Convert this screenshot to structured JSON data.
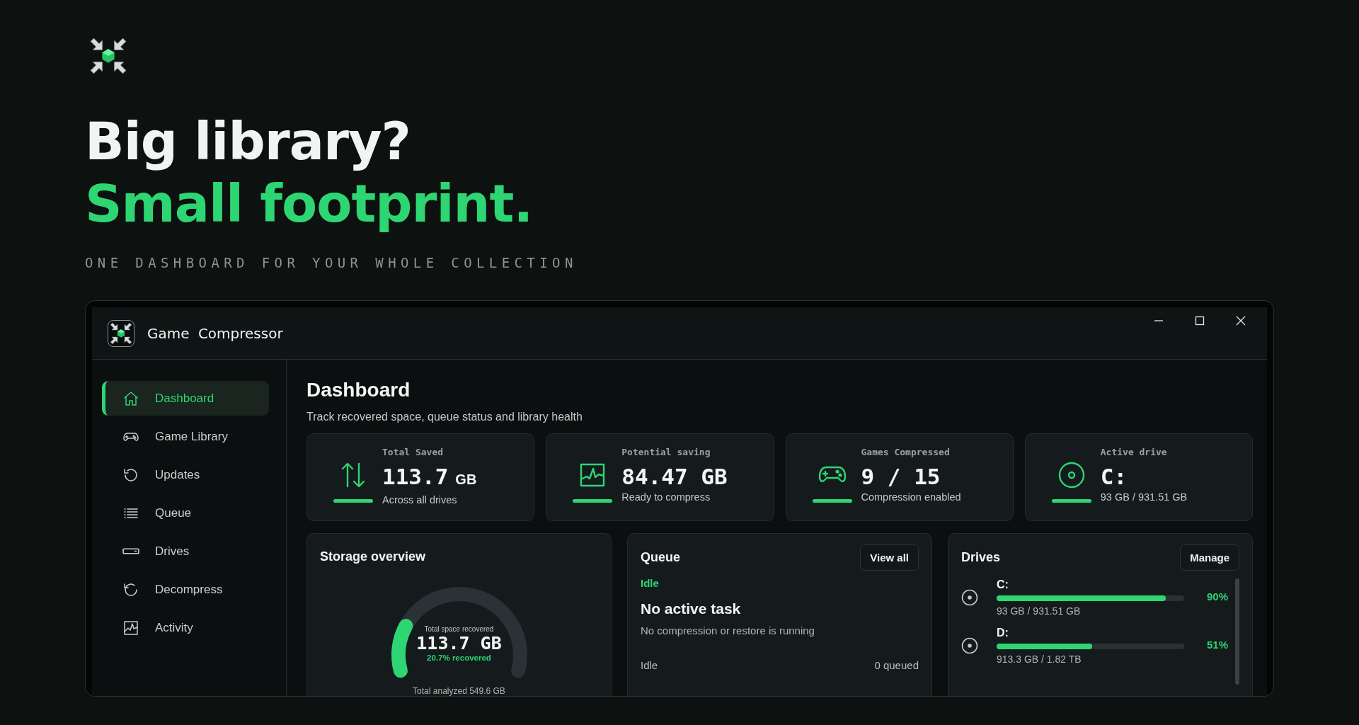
{
  "hero": {
    "headline": "Big library?",
    "highlight": "Small footprint.",
    "tagline": "ONE DASHBOARD FOR YOUR WHOLE COLLECTION"
  },
  "window": {
    "title": "Game Compressor"
  },
  "sidebar": {
    "items": [
      {
        "label": "Dashboard",
        "kind": "home",
        "selected": true
      },
      {
        "label": "Game Library",
        "kind": "gamepad",
        "selected": false
      },
      {
        "label": "Updates",
        "kind": "refresh",
        "selected": false
      },
      {
        "label": "Queue",
        "kind": "list",
        "selected": false
      },
      {
        "label": "Drives",
        "kind": "drive",
        "selected": false
      },
      {
        "label": "Decompress",
        "kind": "restore",
        "selected": false
      },
      {
        "label": "Activity",
        "kind": "activity",
        "selected": false
      }
    ]
  },
  "page": {
    "title": "Dashboard",
    "subtitle": "Track recovered space, queue status and library health"
  },
  "stats": [
    {
      "label": "Total Saved",
      "value": "113.7",
      "unit": "GB",
      "caption": "Across all drives",
      "kind": "transfer"
    },
    {
      "label": "Potential saving",
      "value": "84.47 GB",
      "caption": "Ready to compress",
      "kind": "chart"
    },
    {
      "label": "Games Compressed",
      "value": "9 / 15",
      "caption": "Compression enabled",
      "kind": "gamepad"
    },
    {
      "label": "Active drive",
      "value": "C:",
      "caption": "93 GB / 931.51 GB",
      "kind": "disc"
    }
  ],
  "storage": {
    "title": "Storage overview",
    "gauge_label": "Total space recovered",
    "value": "113.7 GB",
    "percent": "20.7% recovered",
    "level": 0.207,
    "footer": "Total analyzed 549.6 GB"
  },
  "queue": {
    "title": "Queue",
    "button": "View all",
    "status": "Idle",
    "task": "No active task",
    "detail": "No compression or restore is running",
    "footer_left": "Idle",
    "footer_right": "0 queued"
  },
  "drives": {
    "title": "Drives",
    "button": "Manage",
    "items": [
      {
        "name": "C:",
        "level": 0.9,
        "percent": "90%",
        "usage": "93 GB / 931.51 GB"
      },
      {
        "name": "D:",
        "level": 0.51,
        "percent": "51%",
        "usage": "913.3 GB / 1.82 TB"
      }
    ]
  }
}
